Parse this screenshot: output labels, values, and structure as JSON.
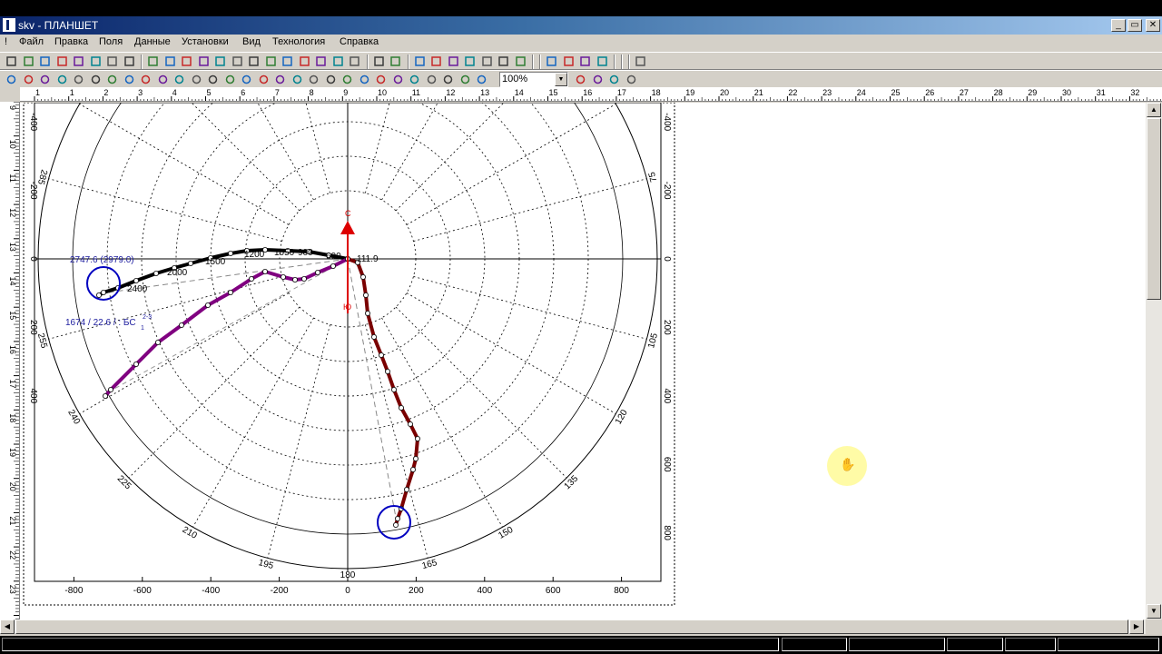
{
  "window": {
    "title": "skv - ПЛАНШЕТ",
    "caption_buttons": [
      "_",
      "▭",
      "✕"
    ]
  },
  "menu": {
    "first": "!",
    "items": [
      "Файл",
      "Правка",
      "Поля",
      "Данные",
      "Установки",
      "Вид",
      "Технология",
      "Справка"
    ]
  },
  "toolbar": {
    "zoom_value": "100%"
  },
  "rulers": {
    "horizontal": [
      "1",
      "1",
      "2",
      "3",
      "4",
      "5",
      "6",
      "7",
      "8",
      "9",
      "10",
      "11",
      "12",
      "13",
      "14",
      "15",
      "16",
      "17",
      "18",
      "19",
      "20",
      "21",
      "22",
      "23",
      "24",
      "25",
      "26",
      "27",
      "28",
      "29",
      "30",
      "31",
      "32",
      "33"
    ],
    "vertical": [
      "9",
      "10",
      "11",
      "12",
      "13",
      "14",
      "15",
      "16",
      "17",
      "18",
      "19",
      "20",
      "21",
      "22",
      "23",
      "24"
    ]
  },
  "plot": {
    "x_ticks": [
      "-800",
      "-600",
      "-400",
      "-200",
      "0",
      "200",
      "400",
      "600",
      "800"
    ],
    "y_ticks_left": [
      "-400",
      "-200",
      "0",
      "200",
      "400"
    ],
    "y_ticks_right": [
      "-400",
      "-200",
      "0",
      "200",
      "400",
      "600",
      "800"
    ],
    "azimuth_labels": [
      "300",
      "285",
      "270",
      "255",
      "240",
      "225",
      "210",
      "195",
      "180",
      "165",
      "150",
      "135",
      "120",
      "105",
      "90",
      "75"
    ],
    "north_label": "С",
    "south_label": "Ю",
    "depth_labels": [
      "2400",
      "2000",
      "1500",
      "1200",
      "1050",
      "900",
      "600",
      "111.9"
    ],
    "annotation_main": "2747.6 (2979.0)",
    "annotation_sub": "1674 / 22.6 / : БС",
    "annotation_sup": "2-3",
    "annotation_sub2": "1"
  },
  "colors": {
    "trajectory_black": "#000000",
    "trajectory_purple": "#800080",
    "trajectory_darkred": "#7a0000",
    "target_circle": "#0000c0",
    "north_arrow": "#dd0000",
    "annotation": "#2020a0"
  }
}
